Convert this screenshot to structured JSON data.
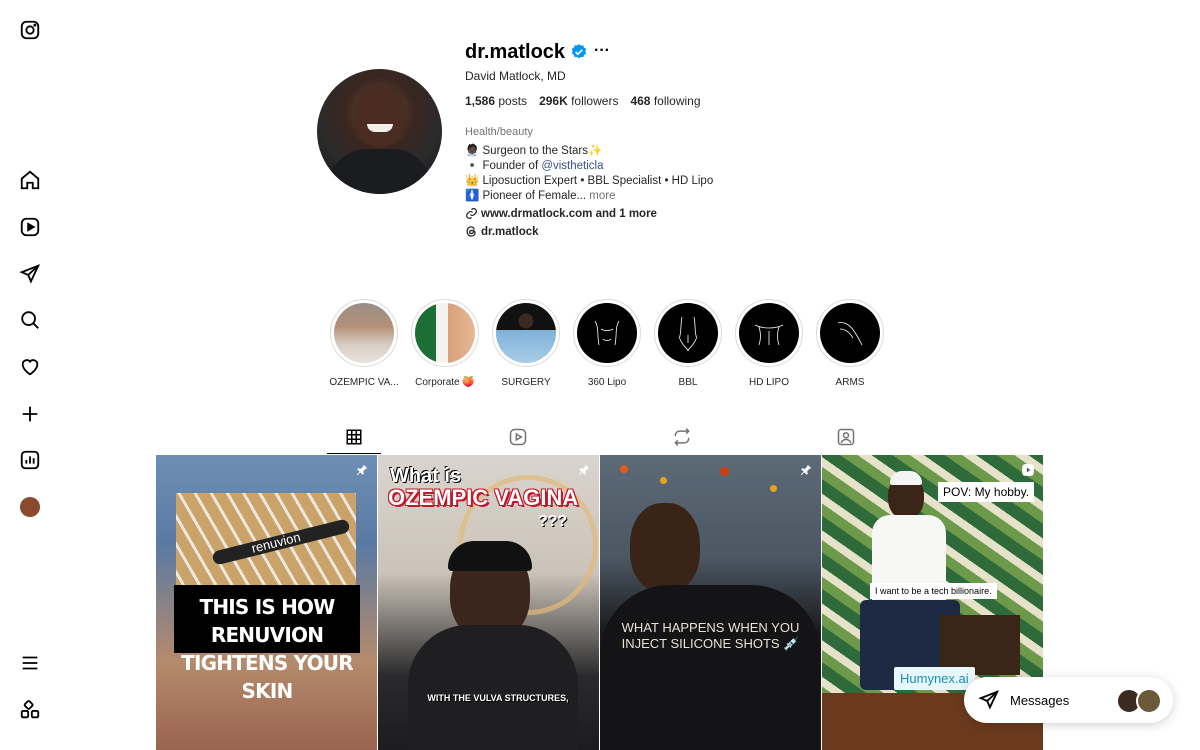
{
  "profile": {
    "username": "dr.matlock",
    "full_name": "David Matlock, MD",
    "more_glyph": "···",
    "stats": [
      {
        "value": "1,586",
        "label": "posts"
      },
      {
        "value": "296K",
        "label": "followers"
      },
      {
        "value": "468",
        "label": "following"
      }
    ],
    "category": "Health/beauty",
    "bio": {
      "line1": "🧑🏿‍⚕️ Surgeon to the Stars✨",
      "line2_prefix": "▪️ Founder of ",
      "line2_link": "@vistheticla",
      "line3": "👑 Liposuction Expert • BBL Specialist • HD Lipo",
      "line4": "🚺 Pioneer of Female...",
      "more": "more"
    },
    "external_link": "www.drmatlock.com and 1 more",
    "threads_handle": "dr.matlock",
    "colors": {
      "verified": "#0095f6",
      "link": "#385185"
    }
  },
  "highlights": [
    {
      "label": "OZEMPIC VA..."
    },
    {
      "label": "Corporate 🍑"
    },
    {
      "label": "SURGERY"
    },
    {
      "label": "360 Lipo"
    },
    {
      "label": "BBL"
    },
    {
      "label": "HD LIPO"
    },
    {
      "label": "ARMS"
    }
  ],
  "tabs": [
    {
      "icon": "grid-icon",
      "active": true
    },
    {
      "icon": "reels-icon",
      "active": false
    },
    {
      "icon": "reposts-icon",
      "active": false
    },
    {
      "icon": "tagged-icon",
      "active": false
    }
  ],
  "posts": [
    {
      "caption_line1": "THIS IS HOW RENUVION",
      "caption_line2": "TIGHTENS YOUR SKIN",
      "product": "renuvion",
      "pinned": true
    },
    {
      "caption_line1": "What is",
      "caption_line2": "OZEMPIC VAGINA",
      "caption_line3": "???",
      "subtitle": "WITH THE VULVA STRUCTURES,",
      "pinned": true
    },
    {
      "caption_line1": "WHAT HAPPENS WHEN YOU",
      "caption_line2": "INJECT SILICONE SHOTS 💉",
      "pinned": true
    },
    {
      "bubble1": "POV: My hobby.",
      "bubble2": "I want to be a tech billionaire.",
      "tag": "Humynex.ai",
      "pinned": false
    }
  ],
  "messages": {
    "label": "Messages"
  },
  "sidebar": {
    "items": [
      "instagram-logo",
      "home",
      "reels",
      "explore",
      "search",
      "notifications",
      "create",
      "dashboard",
      "profile",
      "menu",
      "more-apps"
    ]
  }
}
